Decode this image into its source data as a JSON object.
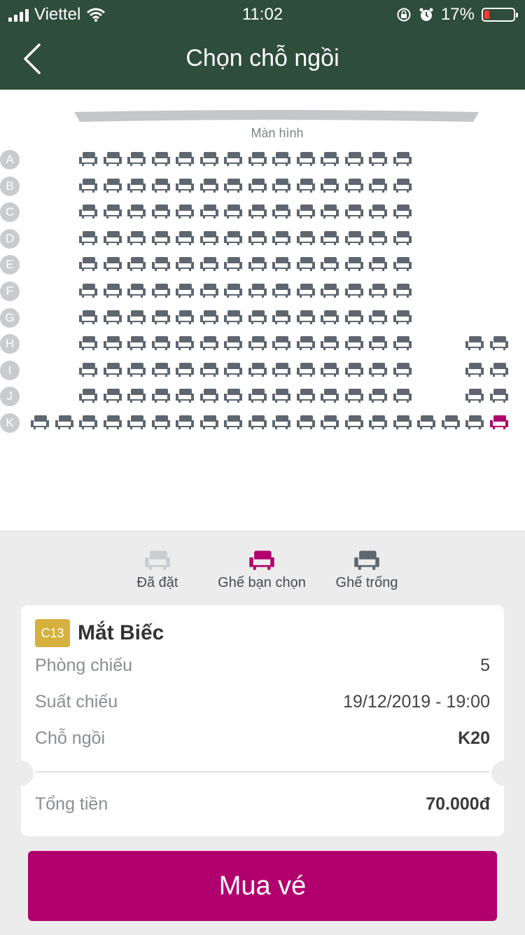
{
  "status_bar": {
    "carrier": "Viettel",
    "time": "11:02",
    "battery_percent": 17,
    "battery_text": "17%"
  },
  "nav": {
    "title": "Chọn chỗ ngồi"
  },
  "screen": {
    "label": "Màn hình"
  },
  "colors": {
    "header": "#2e4d3a",
    "seat_available": "#5e6670",
    "seat_selected": "#b1006e",
    "seat_booked": "#c9ccd0",
    "rating_badge": "#d6b13d",
    "buy_button": "#b1006e"
  },
  "seat_map": {
    "rows": [
      {
        "label": "A",
        "seats": [
          3,
          4,
          5,
          6,
          7,
          8,
          9,
          10,
          11,
          12,
          13,
          14,
          15,
          16
        ]
      },
      {
        "label": "B",
        "seats": [
          3,
          4,
          5,
          6,
          7,
          8,
          9,
          10,
          11,
          12,
          13,
          14,
          15,
          16
        ]
      },
      {
        "label": "C",
        "seats": [
          3,
          4,
          5,
          6,
          7,
          8,
          9,
          10,
          11,
          12,
          13,
          14,
          15,
          16
        ]
      },
      {
        "label": "D",
        "seats": [
          3,
          4,
          5,
          6,
          7,
          8,
          9,
          10,
          11,
          12,
          13,
          14,
          15,
          16
        ]
      },
      {
        "label": "E",
        "seats": [
          3,
          4,
          5,
          6,
          7,
          8,
          9,
          10,
          11,
          12,
          13,
          14,
          15,
          16
        ]
      },
      {
        "label": "F",
        "seats": [
          3,
          4,
          5,
          6,
          7,
          8,
          9,
          10,
          11,
          12,
          13,
          14,
          15,
          16
        ]
      },
      {
        "label": "G",
        "seats": [
          3,
          4,
          5,
          6,
          7,
          8,
          9,
          10,
          11,
          12,
          13,
          14,
          15,
          16
        ]
      },
      {
        "label": "H",
        "seats": [
          3,
          4,
          5,
          6,
          7,
          8,
          9,
          10,
          11,
          12,
          13,
          14,
          15,
          16,
          19,
          20
        ]
      },
      {
        "label": "I",
        "seats": [
          3,
          4,
          5,
          6,
          7,
          8,
          9,
          10,
          11,
          12,
          13,
          14,
          15,
          16,
          19,
          20
        ]
      },
      {
        "label": "J",
        "seats": [
          3,
          4,
          5,
          6,
          7,
          8,
          9,
          10,
          11,
          12,
          13,
          14,
          15,
          16,
          19,
          20
        ]
      },
      {
        "label": "K",
        "seats": [
          1,
          2,
          3,
          4,
          5,
          6,
          7,
          8,
          9,
          10,
          11,
          12,
          13,
          14,
          15,
          16,
          17,
          18,
          19,
          20
        ]
      }
    ],
    "selected": [
      "K20"
    ]
  },
  "legend": [
    {
      "label": "Đã đặt",
      "status": "booked"
    },
    {
      "label": "Ghế bạn chọn",
      "status": "selected"
    },
    {
      "label": "Ghế trống",
      "status": "available"
    }
  ],
  "booking": {
    "rating": "C13",
    "movie": "Mắt Biếc",
    "room_label": "Phòng chiếu",
    "room_value": "5",
    "showtime_label": "Suất chiếu",
    "showtime_value": "19/12/2019 - 19:00",
    "seat_label": "Chỗ ngồi",
    "seat_value": "K20",
    "total_label": "Tổng tiền",
    "total_value": "70.000đ"
  },
  "buy_button": {
    "label": "Mua vé"
  }
}
